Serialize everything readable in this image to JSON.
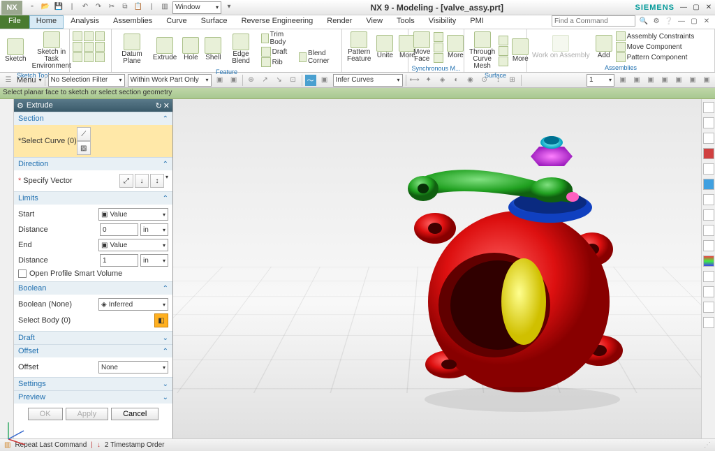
{
  "title": "NX 9 - Modeling - [valve_assy.prt]",
  "brand": "SIEMENS",
  "window_dropdown": "Window",
  "menubar": {
    "file": "File",
    "items": [
      "Home",
      "Analysis",
      "Assemblies",
      "Curve",
      "Surface",
      "Reverse Engineering",
      "Render",
      "View",
      "Tools",
      "Visibility",
      "PMI"
    ],
    "active": "Home",
    "search_placeholder": "Find a Command"
  },
  "ribbon": {
    "sketch": "Sketch",
    "sketch_task": "Sketch in Task Environment",
    "sketch_tools": "Sketch Tools",
    "datum_plane": "Datum Plane",
    "extrude": "Extrude",
    "hole": "Hole",
    "shell": "Shell",
    "edge_blend": "Edge Blend",
    "trim_body": "Trim Body",
    "draft": "Draft",
    "rib": "Rib",
    "blend_corner": "Blend Corner",
    "pattern_feature": "Pattern Feature",
    "unite": "Unite",
    "more1": "More",
    "feature": "Feature",
    "move_face": "Move Face",
    "more2": "More",
    "sync": "Synchronous M...",
    "through_curve_mesh": "Through Curve Mesh",
    "more3": "More",
    "surface": "Surface",
    "work_on_assembly": "Work on Assembly",
    "add": "Add",
    "assembly_constraints": "Assembly Constraints",
    "move_component": "Move Component",
    "pattern_component": "Pattern Component",
    "assemblies": "Assemblies"
  },
  "selbar": {
    "menu": "Menu",
    "no_filter": "No Selection Filter",
    "within": "Within Work Part Only",
    "infer": "Infer Curves",
    "count": "1"
  },
  "prompt": "Select planar face to sketch or select section geometry",
  "dialog": {
    "title": "Extrude",
    "section": "Section",
    "select_curve": "Select Curve (0)",
    "direction": "Direction",
    "specify_vector": "Specify Vector",
    "limits": "Limits",
    "start": "Start",
    "end": "End",
    "distance": "Distance",
    "value": "Value",
    "start_val": "0",
    "end_val": "1",
    "unit": "in",
    "open_profile": "Open Profile Smart Volume",
    "boolean": "Boolean",
    "boolean_none": "Boolean (None)",
    "inferred": "Inferred",
    "select_body": "Select Body (0)",
    "draft": "Draft",
    "offset": "Offset",
    "offset_val": "None",
    "settings": "Settings",
    "preview": "Preview",
    "ok": "OK",
    "apply": "Apply",
    "cancel": "Cancel"
  },
  "status": {
    "repeat": "Repeat Last Command",
    "timestamp": "2 Timestamp Order"
  }
}
